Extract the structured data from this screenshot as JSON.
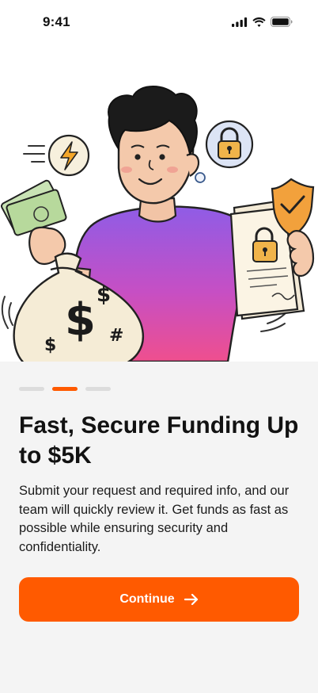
{
  "status_bar": {
    "time": "9:41",
    "icons": [
      "signal-icon",
      "wifi-icon",
      "battery-icon"
    ]
  },
  "hero": {
    "illustration": "person-holding-money-bag-and-secure-document",
    "icons": [
      "lightning-icon",
      "padlock-icon",
      "shield-check-icon",
      "dollar-sign-icon"
    ]
  },
  "onboarding": {
    "pager": {
      "total": 3,
      "active_index": 1
    },
    "title": "Fast, Secure Funding Up to $5K",
    "description": "Submit your request and required info, and our team will quickly review it. Get funds as fast as possible while ensuring security and confidentiality.",
    "continue_label": "Continue"
  },
  "colors": {
    "accent": "#ff5a00",
    "sheet_background": "#f4f4f4",
    "inactive_dot": "#dcdcdc"
  }
}
